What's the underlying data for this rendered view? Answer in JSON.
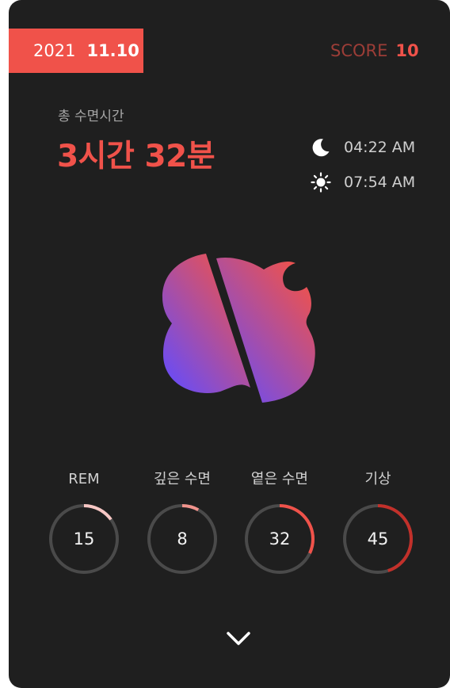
{
  "header": {
    "year": "2021",
    "month_day": "11.10",
    "score_label": "SCORE",
    "score_value": "10"
  },
  "sleep": {
    "total_label": "총 수면시간",
    "total_value": "3시간 32분",
    "bedtime": "04:22 AM",
    "wake_time": "07:54 AM"
  },
  "stats": [
    {
      "label": "REM",
      "value": "15",
      "progress": 0.15,
      "color": "#f7c7c4"
    },
    {
      "label": "깊은 수면",
      "value": "8",
      "progress": 0.08,
      "color": "#f0938c"
    },
    {
      "label": "옅은 수면",
      "value": "32",
      "progress": 0.32,
      "color": "#f0524a"
    },
    {
      "label": "기상",
      "value": "45",
      "progress": 0.45,
      "color": "#c2302a"
    }
  ],
  "icons": {
    "bedtime": "moon-icon",
    "wake": "sun-icon",
    "expand": "chevron-down-icon"
  },
  "colors": {
    "accent": "#f0524a",
    "background": "#1f1f1f",
    "logo_gradient_start": "#f0524a",
    "logo_gradient_end": "#6a4cf5"
  }
}
